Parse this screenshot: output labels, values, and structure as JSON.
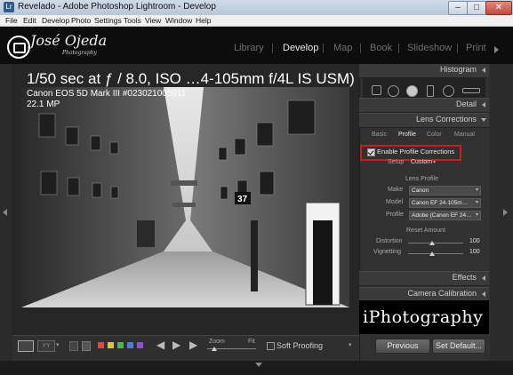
{
  "window": {
    "title": "Revelado - Adobe Photoshop Lightroom - Develop",
    "app_icon": "Lr",
    "minimize": "–",
    "maximize": "□",
    "close": "✕"
  },
  "menu": {
    "items": [
      "File",
      "Edit",
      "Develop",
      "Photo",
      "Settings",
      "Tools",
      "View",
      "Window",
      "Help"
    ]
  },
  "identity": {
    "name": "José Ojeda",
    "sub": "Photography"
  },
  "modules": {
    "items": [
      "Library",
      "Develop",
      "Map",
      "Book",
      "Slideshow",
      "Print"
    ],
    "active": "Develop",
    "separator": "|"
  },
  "overlay": {
    "line1": "1/50 sec at ƒ / 8.0, ISO …4-105mm f/4L IS USM)",
    "line2": "Canon EOS 5D Mark III #023021005911",
    "line3": "22.1 MP"
  },
  "photo": {
    "sign_number": "37"
  },
  "panel": {
    "histogram_title": "Histogram",
    "detail_title": "Detail",
    "lens_title": "Lens Corrections",
    "tabs": [
      "Basic",
      "Profile",
      "Color",
      "Manual"
    ],
    "active_tab": "Profile",
    "enable_label": "Enable Profile Corrections",
    "enable_checked": true,
    "setup_label": "Setup",
    "setup_value": "Custom",
    "lens_profile_title": "Lens Profile",
    "make_label": "Make",
    "make_value": "Canon",
    "model_label": "Model",
    "model_value": "Canon EF 24-105m…",
    "profile_label": "Profile",
    "profile_value": "Adobe (Canon EF 24…",
    "amount_title": "Reset Amount",
    "distortion_label": "Distortion",
    "distortion_value": "100",
    "vignetting_label": "Vignetting",
    "vignetting_value": "100",
    "effects_title": "Effects",
    "calibration_title": "Camera Calibration",
    "watermark": "iPhotography",
    "previous_label": "Previous",
    "set_default_label": "Set Default..."
  },
  "toolbar": {
    "zoom_label": "Zoom",
    "fit_label": "Fit",
    "soft_proof_label": "Soft Proofing",
    "color_labels": [
      "#d84a4a",
      "#d8c24a",
      "#4ab84a",
      "#4a7fd8",
      "#9a4ad8"
    ]
  }
}
